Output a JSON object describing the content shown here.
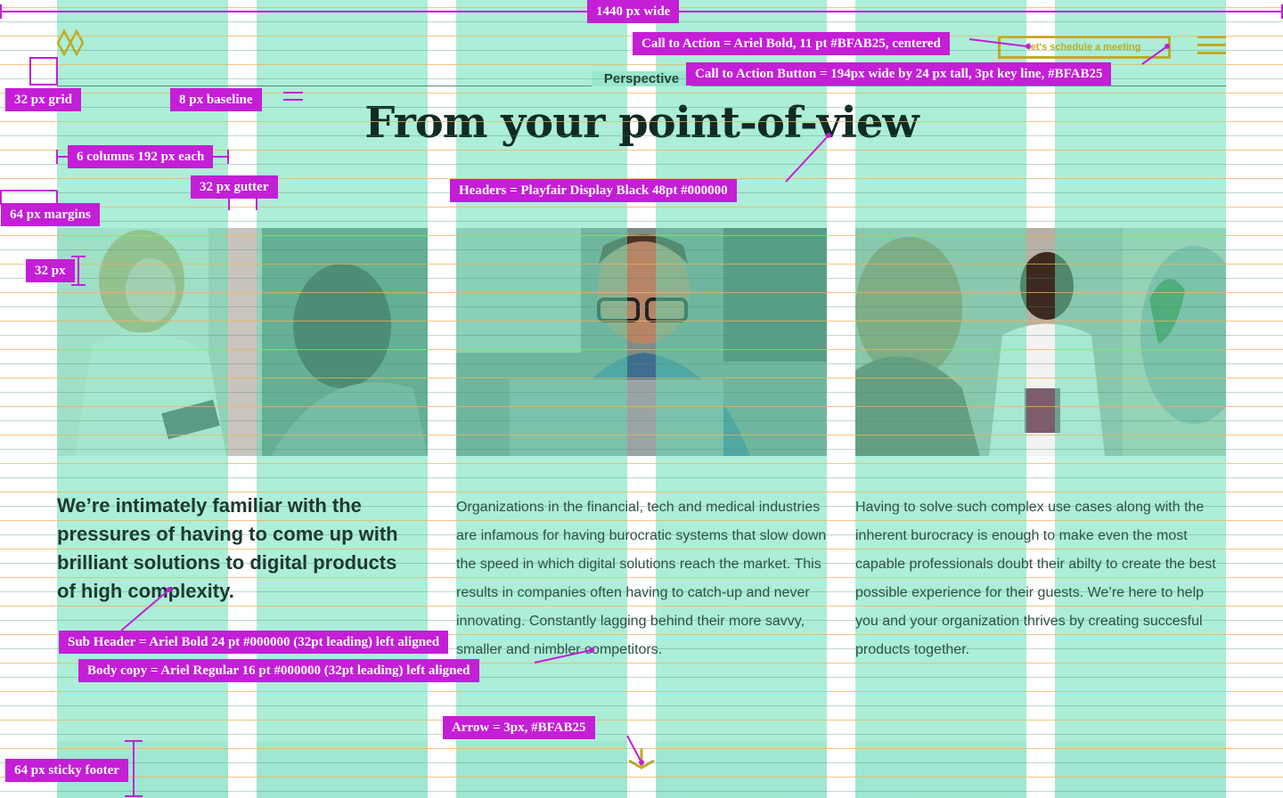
{
  "header": {
    "logo_icon": "diamond-chevron-logo-icon",
    "cta_label": "let's schedule a meeting",
    "menu_icon": "hamburger-icon"
  },
  "section": {
    "label": "Perspective",
    "headline": "From your point-of-view"
  },
  "photos": [
    {
      "name": "photo-doctor-consult",
      "icon": "photo-icon"
    },
    {
      "name": "photo-developer-laptop",
      "icon": "photo-icon"
    },
    {
      "name": "photo-meeting-tablet",
      "icon": "photo-icon"
    }
  ],
  "content": {
    "subheader": "We’re intimately familiar with the pressures of having to come up with brilliant solutions to digital products of high complexity.",
    "body_1": "Organizations in the financial, tech and medical industries are infamous for having burocratic systems that slow down the speed in which digital solutions reach the market. This results in companies often having to catch-up and never innovating. Constantly lagging behind their more savvy, smaller and nimbler competitors.",
    "body_2": "Having to solve such complex use cases along with the inherent burocracy is enough to make even the most capable professionals doubt their abilty to create the best possible experience for their guests. We’re here to help you and your organization thrives by creating succesful products together."
  },
  "footer": {
    "arrow_icon": "chevron-down-arrow-icon"
  },
  "annotations": {
    "width": "1440 px wide",
    "cta": "Call to Action = Ariel Bold, 11 pt #BFAB25, centered",
    "cta_button": "Call to Action Button = 194px wide by 24 px tall, 3pt key line, #BFAB25",
    "grid": "32 px grid",
    "baseline": "8 px baseline",
    "columns": "6 columns 192 px each",
    "gutter": "32 px gutter",
    "headers": "Headers = Playfair Display Black 48pt #000000",
    "margins": "64 px margins",
    "spacing": "32 px",
    "subheader": "Sub Header = Ariel Bold 24 pt #000000 (32pt leading) left aligned",
    "body": "Body copy = Ariel Regular 16 pt #000000 (32pt leading) left aligned",
    "arrow": "Arrow = 3px, #BFAB25",
    "footer": "64 px sticky footer"
  },
  "colors": {
    "accent": "#BFAB25",
    "annotation": "#C41ED6",
    "grid_column": "#60DEB4",
    "baseline": "#F0B35A"
  }
}
